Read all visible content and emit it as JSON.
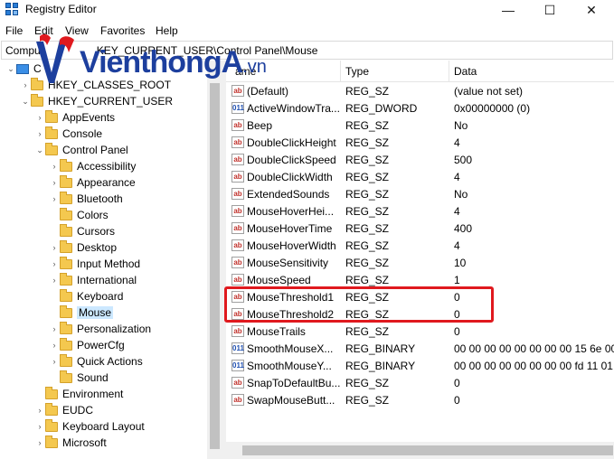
{
  "window": {
    "title": "Registry Editor",
    "minimize": "—",
    "maximize": "☐",
    "close": "✕"
  },
  "menu": [
    "File",
    "Edit",
    "View",
    "Favorites",
    "Help"
  ],
  "address": "Computer\\HKEY_CURRENT_USER\\Control Panel\\Mouse",
  "address_visible": "Compu",
  "address_visible_tail": "KEY_CURRENT_USER\\Control Panel\\Mouse",
  "logo": {
    "text": "VienthongA",
    "suffix": ".vn",
    "color": "#1d3f9e",
    "accent": "#e0191e"
  },
  "tree": {
    "root": "C",
    "items": [
      {
        "label": "HKEY_CLASSES_ROOT",
        "level": 1,
        "expanded": false
      },
      {
        "label": "HKEY_CURRENT_USER",
        "level": 1,
        "expanded": true
      },
      {
        "label": "AppEvents",
        "level": 2,
        "expanded": false
      },
      {
        "label": "Console",
        "level": 2,
        "expanded": false
      },
      {
        "label": "Control Panel",
        "level": 2,
        "expanded": true
      },
      {
        "label": "Accessibility",
        "level": 3,
        "expanded": false
      },
      {
        "label": "Appearance",
        "level": 3,
        "expanded": false
      },
      {
        "label": "Bluetooth",
        "level": 3,
        "expanded": false
      },
      {
        "label": "Colors",
        "level": 3,
        "leaf": true
      },
      {
        "label": "Cursors",
        "level": 3,
        "leaf": true
      },
      {
        "label": "Desktop",
        "level": 3,
        "expanded": false
      },
      {
        "label": "Input Method",
        "level": 3,
        "expanded": false
      },
      {
        "label": "International",
        "level": 3,
        "expanded": false
      },
      {
        "label": "Keyboard",
        "level": 3,
        "leaf": true
      },
      {
        "label": "Mouse",
        "level": 3,
        "leaf": true,
        "selected": true
      },
      {
        "label": "Personalization",
        "level": 3,
        "expanded": false
      },
      {
        "label": "PowerCfg",
        "level": 3,
        "expanded": false
      },
      {
        "label": "Quick Actions",
        "level": 3,
        "expanded": false
      },
      {
        "label": "Sound",
        "level": 3,
        "leaf": true
      },
      {
        "label": "Environment",
        "level": 2,
        "leaf": true
      },
      {
        "label": "EUDC",
        "level": 2,
        "expanded": false
      },
      {
        "label": "Keyboard Layout",
        "level": 2,
        "expanded": false
      },
      {
        "label": "Microsoft",
        "level": 2,
        "expanded": false
      }
    ]
  },
  "list": {
    "columns": [
      "Name",
      "Type",
      "Data"
    ],
    "columns_visible": [
      "ame",
      "Type",
      "Data"
    ],
    "rows": [
      {
        "name": "(Default)",
        "type": "REG_SZ",
        "data": "(value not set)",
        "kind": "sz"
      },
      {
        "name": "ActiveWindowTra...",
        "type": "REG_DWORD",
        "data": "0x00000000 (0)",
        "kind": "bin"
      },
      {
        "name": "Beep",
        "type": "REG_SZ",
        "data": "No",
        "kind": "sz"
      },
      {
        "name": "DoubleClickHeight",
        "type": "REG_SZ",
        "data": "4",
        "kind": "sz"
      },
      {
        "name": "DoubleClickSpeed",
        "type": "REG_SZ",
        "data": "500",
        "kind": "sz"
      },
      {
        "name": "DoubleClickWidth",
        "type": "REG_SZ",
        "data": "4",
        "kind": "sz"
      },
      {
        "name": "ExtendedSounds",
        "type": "REG_SZ",
        "data": "No",
        "kind": "sz"
      },
      {
        "name": "MouseHoverHei...",
        "type": "REG_SZ",
        "data": "4",
        "kind": "sz"
      },
      {
        "name": "MouseHoverTime",
        "type": "REG_SZ",
        "data": "400",
        "kind": "sz"
      },
      {
        "name": "MouseHoverWidth",
        "type": "REG_SZ",
        "data": "4",
        "kind": "sz"
      },
      {
        "name": "MouseSensitivity",
        "type": "REG_SZ",
        "data": "10",
        "kind": "sz"
      },
      {
        "name": "MouseSpeed",
        "type": "REG_SZ",
        "data": "1",
        "kind": "sz"
      },
      {
        "name": "MouseThreshold1",
        "type": "REG_SZ",
        "data": "0",
        "kind": "sz"
      },
      {
        "name": "MouseThreshold2",
        "type": "REG_SZ",
        "data": "0",
        "kind": "sz"
      },
      {
        "name": "MouseTrails",
        "type": "REG_SZ",
        "data": "0",
        "kind": "sz"
      },
      {
        "name": "SmoothMouseX...",
        "type": "REG_BINARY",
        "data": "00 00 00 00 00 00 00 00 15 6e 00 0",
        "kind": "bin"
      },
      {
        "name": "SmoothMouseY...",
        "type": "REG_BINARY",
        "data": "00 00 00 00 00 00 00 00 fd 11 01 0",
        "kind": "bin"
      },
      {
        "name": "SnapToDefaultBu...",
        "type": "REG_SZ",
        "data": "0",
        "kind": "sz"
      },
      {
        "name": "SwapMouseButt...",
        "type": "REG_SZ",
        "data": "0",
        "kind": "sz"
      }
    ]
  },
  "icons": {
    "sz": "ab",
    "bin": "011"
  },
  "colors": {
    "highlight_box": "#e0191e",
    "selection": "#cce8ff",
    "folder": "#f4c84f"
  }
}
